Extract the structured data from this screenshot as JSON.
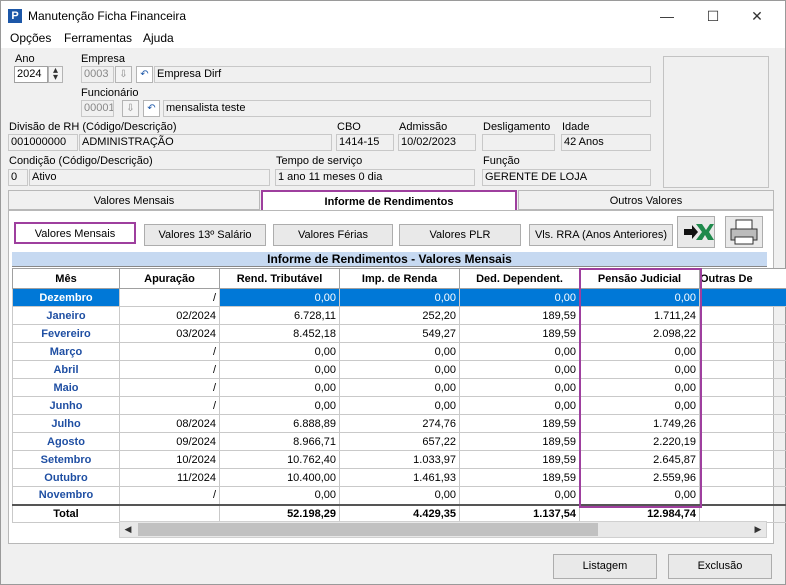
{
  "window": {
    "title": "Manutenção Ficha Financeira",
    "app_icon": "P"
  },
  "menu": [
    "Opções",
    "Ferramentas",
    "Ajuda"
  ],
  "form": {
    "ano_label": "Ano",
    "ano_value": "2024",
    "empresa_label": "Empresa",
    "empresa_code": "0003",
    "empresa_name": "Empresa Dirf",
    "funcionario_label": "Funcionário",
    "funcionario_code": "00001",
    "funcionario_name": "mensalista teste",
    "divisao_label": "Divisão de RH (Código/Descrição)",
    "divisao_code": "001000000",
    "divisao_desc": "ADMINISTRAÇÃO",
    "cbo_label": "CBO",
    "cbo_value": "1414-15",
    "admissao_label": "Admissão",
    "admissao_value": "10/02/2023",
    "desligamento_label": "Desligamento",
    "desligamento_value": "",
    "idade_label": "Idade",
    "idade_value": "42 Anos",
    "condicao_label": "Condição (Código/Descrição)",
    "condicao_code": "0",
    "condicao_desc": "Ativo",
    "tempo_label": "Tempo de serviço",
    "tempo_value": "1 ano 11 meses 0 dia",
    "funcao_label": "Função",
    "funcao_value": "GERENTE DE LOJA"
  },
  "tabs": [
    "Valores Mensais",
    "Informe de Rendimentos",
    "Outros Valores"
  ],
  "subbuttons": [
    "Valores Mensais",
    "Valores 13º Salário",
    "Valores Férias",
    "Valores PLR",
    "Vls. RRA (Anos Anteriores)"
  ],
  "icons": {
    "excel": "excel-export-icon",
    "print": "printer-icon"
  },
  "grid": {
    "title": "Informe de Rendimentos - Valores Mensais",
    "columns": [
      "Mês",
      "Apuração",
      "Rend. Tributável",
      "Imp. de Renda",
      "Ded. Dependent.",
      "Pensão Judicial",
      "Outras De"
    ],
    "rows": [
      [
        "Dezembro",
        "/",
        "0,00",
        "0,00",
        "0,00",
        "0,00"
      ],
      [
        "Janeiro",
        "02/2024",
        "6.728,11",
        "252,20",
        "189,59",
        "1.711,24"
      ],
      [
        "Fevereiro",
        "03/2024",
        "8.452,18",
        "549,27",
        "189,59",
        "2.098,22"
      ],
      [
        "Março",
        "/",
        "0,00",
        "0,00",
        "0,00",
        "0,00"
      ],
      [
        "Abril",
        "/",
        "0,00",
        "0,00",
        "0,00",
        "0,00"
      ],
      [
        "Maio",
        "/",
        "0,00",
        "0,00",
        "0,00",
        "0,00"
      ],
      [
        "Junho",
        "/",
        "0,00",
        "0,00",
        "0,00",
        "0,00"
      ],
      [
        "Julho",
        "08/2024",
        "6.888,89",
        "274,76",
        "189,59",
        "1.749,26"
      ],
      [
        "Agosto",
        "09/2024",
        "8.966,71",
        "657,22",
        "189,59",
        "2.220,19"
      ],
      [
        "Setembro",
        "10/2024",
        "10.762,40",
        "1.033,97",
        "189,59",
        "2.645,87"
      ],
      [
        "Outubro",
        "11/2024",
        "10.400,00",
        "1.461,93",
        "189,59",
        "2.559,96"
      ],
      [
        "Novembro",
        "/",
        "0,00",
        "0,00",
        "0,00",
        "0,00"
      ]
    ],
    "total": [
      "Total",
      "",
      "52.198,29",
      "4.429,35",
      "1.137,54",
      "12.984,74"
    ]
  },
  "footer": {
    "listagem": "Listagem",
    "exclusao": "Exclusão"
  },
  "colors": {
    "highlight": "#9e3f9e",
    "selected_row": "#0078d7",
    "grid_title_bg": "#c6d9f1",
    "month_text": "#1f4fa3"
  }
}
